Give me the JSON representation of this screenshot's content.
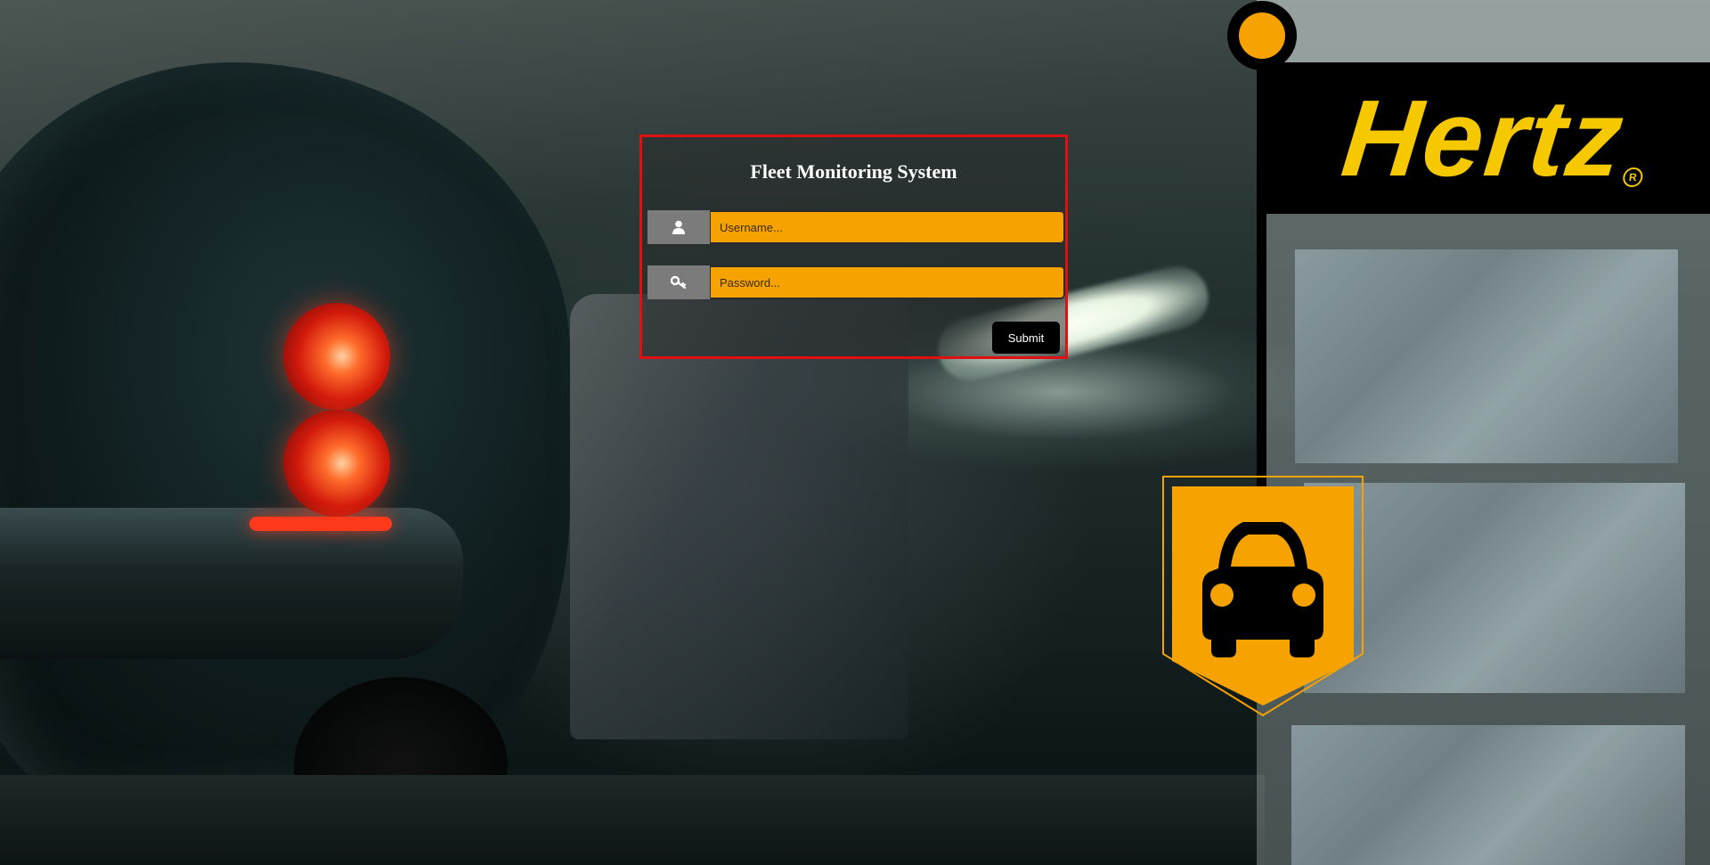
{
  "login": {
    "title": "Fleet Monitoring System",
    "username_placeholder": "Username...",
    "password_placeholder": "Password...",
    "submit_label": "Submit",
    "username_icon": "user-icon",
    "password_icon": "key-icon"
  },
  "brand": {
    "logo_text": "Hertz",
    "registered_mark": "R"
  },
  "colors": {
    "accent": "#f6a200",
    "brand_yellow": "#f6c800",
    "panel_border": "#e01010",
    "icon_bg": "#7b7b7b"
  }
}
